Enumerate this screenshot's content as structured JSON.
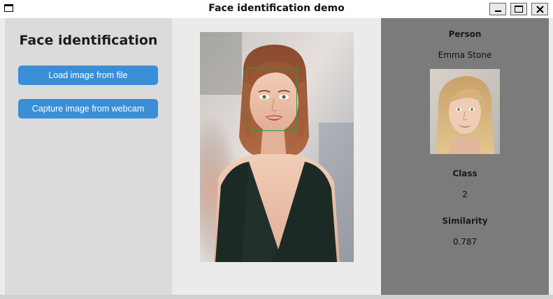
{
  "window": {
    "title": "Face identification demo"
  },
  "left_panel": {
    "heading": "Face identification",
    "load_button_label": "Load image from file",
    "capture_button_label": "Capture image from webcam"
  },
  "center_panel": {
    "photo_icon": "portrait-photo",
    "face_box_color": "#2d9a2d"
  },
  "results": {
    "person_label": "Person",
    "person_value": "Emma Stone",
    "thumbnail_icon": "reference-portrait",
    "class_label": "Class",
    "class_value": "2",
    "similarity_label": "Similarity",
    "similarity_value": "0.787"
  },
  "colors": {
    "button": "#3a8fd6",
    "left_panel_bg": "#dbdbdb",
    "center_panel_bg": "#ebebeb",
    "right_panel_bg": "#7b7b7b"
  }
}
